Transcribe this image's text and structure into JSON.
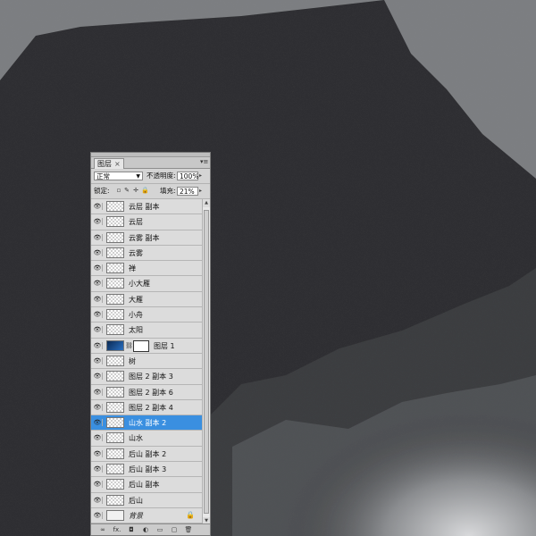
{
  "panel": {
    "tab_label": "图层",
    "tab_close": "×",
    "menu_icon": "panel-menu-icon"
  },
  "controls": {
    "blend_mode": "正常",
    "opacity_label": "不透明度:",
    "opacity_value": "100%",
    "lock_label": "锁定:",
    "fill_label": "填充:",
    "fill_value": "21%"
  },
  "layers": [
    {
      "name": "云层 副本",
      "thumb": "transparent",
      "selected": false
    },
    {
      "name": "云层",
      "thumb": "transparent",
      "selected": false
    },
    {
      "name": "云雾 副本",
      "thumb": "transparent",
      "selected": false
    },
    {
      "name": "云雾",
      "thumb": "transparent",
      "selected": false
    },
    {
      "name": "禅",
      "thumb": "transparent",
      "selected": false
    },
    {
      "name": "小大雁",
      "thumb": "transparent",
      "selected": false
    },
    {
      "name": "大雁",
      "thumb": "transparent",
      "selected": false
    },
    {
      "name": "小舟",
      "thumb": "transparent",
      "selected": false
    },
    {
      "name": "太阳",
      "thumb": "transparent",
      "selected": false
    },
    {
      "name": "图层 1",
      "thumb": "blue-gradient",
      "selected": false,
      "has_mask": true
    },
    {
      "name": "树",
      "thumb": "transparent",
      "selected": false
    },
    {
      "name": "图层 2 副本 3",
      "thumb": "transparent",
      "selected": false
    },
    {
      "name": "图层 2 副本 6",
      "thumb": "transparent",
      "selected": false
    },
    {
      "name": "图层 2 副本 4",
      "thumb": "transparent",
      "selected": false
    },
    {
      "name": "山水 副本 2",
      "thumb": "transparent",
      "selected": true
    },
    {
      "name": "山水",
      "thumb": "transparent",
      "selected": false
    },
    {
      "name": "后山 副本 2",
      "thumb": "transparent",
      "selected": false
    },
    {
      "name": "后山 副本 3",
      "thumb": "transparent",
      "selected": false
    },
    {
      "name": "后山 副本",
      "thumb": "transparent",
      "selected": false
    },
    {
      "name": "后山",
      "thumb": "transparent",
      "selected": false
    },
    {
      "name": "背景",
      "thumb": "white",
      "selected": false,
      "italic": true,
      "locked": true
    }
  ],
  "toolbar_icons": [
    "link-layers-icon",
    "fx-icon",
    "add-mask-icon",
    "adjustment-layer-icon",
    "new-group-icon",
    "new-layer-icon",
    "delete-layer-icon"
  ],
  "toolbar_glyphs": [
    "∞",
    "fx.",
    "◘",
    "◐",
    "▭",
    "▢",
    "🗑"
  ],
  "colors": {
    "selection": "#3a8fe0",
    "canvas_bg": "#7b7d80",
    "mountain": "#2e2f31"
  }
}
